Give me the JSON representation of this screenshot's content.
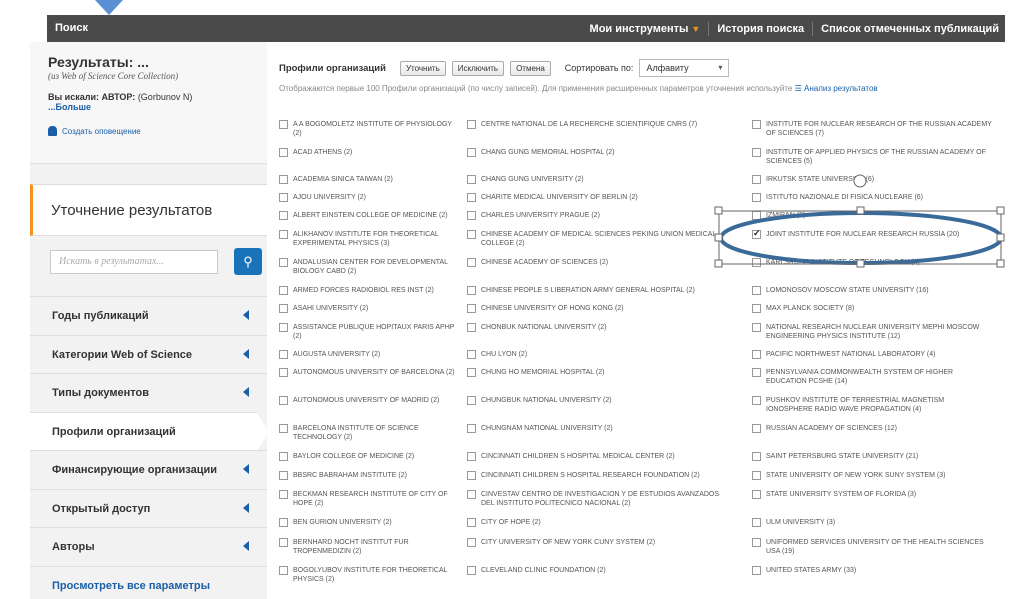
{
  "topbar": {
    "title": "Поиск",
    "tools": "Мои инструменты",
    "history": "История поиска",
    "marked": "Список отмеченных публикаций"
  },
  "sidebar": {
    "results_title": "Результаты: ...",
    "collection": "(из Web of Science Core Collection)",
    "searched_label": "Вы искали: АВТОР:",
    "searched_value": "(Gorbunov N)",
    "more": "...Больше",
    "create_alert": "Создать оповещение",
    "refine_title": "Уточнение результатов",
    "search_placeholder": "Искать в результатах...",
    "nav": [
      {
        "label": "Годы публикаций"
      },
      {
        "label": "Категории Web of Science"
      },
      {
        "label": "Типы документов"
      },
      {
        "label": "Профили организаций"
      },
      {
        "label": "Финансирующие организации"
      },
      {
        "label": "Открытый доступ"
      },
      {
        "label": "Авторы"
      },
      {
        "label": "Просмотреть все параметры"
      }
    ]
  },
  "main": {
    "heading": "Профили организаций",
    "btn_refine": "Уточнить",
    "btn_exclude": "Исключить",
    "btn_cancel": "Отмена",
    "sort_label": "Сортировать по:",
    "sort_value": "Алфавиту",
    "note": "Отображаются первые 100 Профили организаций (по числу записей). Для применения расширенных параметров уточнения используйте",
    "note_link": "Анализ результатов",
    "col1": [
      {
        "t": "A A BOGOMOLETZ INSTITUTE OF PHYSIOLOGY (2)",
        "c": false
      },
      {
        "t": "ACAD ATHENS (2)",
        "c": false
      },
      {
        "t": "ACADEMIA SINICA TAIWAN (2)",
        "c": false
      },
      {
        "t": "AJOU UNIVERSITY (2)",
        "c": false
      },
      {
        "t": "ALBERT EINSTEIN COLLEGE OF MEDICINE (2)",
        "c": false
      },
      {
        "t": "ALIKHANOV INSTITUTE FOR THEORETICAL EXPERIMENTAL PHYSICS (3)",
        "c": false
      },
      {
        "t": "ANDALUSIAN CENTER FOR DEVELOPMENTAL BIOLOGY CABD (2)",
        "c": false
      },
      {
        "t": "ARMED FORCES RADIOBIOL RES INST (2)",
        "c": false
      },
      {
        "t": "ASAHI UNIVERSITY (2)",
        "c": false
      },
      {
        "t": "ASSISTANCE PUBLIQUE HOPITAUX PARIS APHP (2)",
        "c": false
      },
      {
        "t": "AUGUSTA UNIVERSITY (2)",
        "c": false
      },
      {
        "t": "AUTONOMOUS UNIVERSITY OF BARCELONA (2)",
        "c": false
      },
      {
        "t": "AUTONOMOUS UNIVERSITY OF MADRID (2)",
        "c": false
      },
      {
        "t": "BARCELONA INSTITUTE OF SCIENCE TECHNOLOGY (2)",
        "c": false
      },
      {
        "t": "BAYLOR COLLEGE OF MEDICINE (2)",
        "c": false
      },
      {
        "t": "BBSRC BABRAHAM INSTITUTE (2)",
        "c": false
      },
      {
        "t": "BECKMAN RESEARCH INSTITUTE OF CITY OF HOPE (2)",
        "c": false
      },
      {
        "t": "BEN GURION UNIVERSITY (2)",
        "c": false
      },
      {
        "t": "BERNHARD NOCHT INSTITUT FUR TROPENMEDIZIN (2)",
        "c": false
      },
      {
        "t": "BOGOLYUBOV INSTITUTE FOR THEORETICAL PHYSICS (2)",
        "c": false
      }
    ],
    "col2": [
      {
        "t": "CENTRE NATIONAL DE LA RECHERCHE SCIENTIFIQUE CNRS (7)",
        "c": false
      },
      {
        "t": "CHANG GUNG MEMORIAL HOSPITAL (2)",
        "c": false
      },
      {
        "t": "CHANG GUNG UNIVERSITY (2)",
        "c": false
      },
      {
        "t": "CHARITE MEDICAL UNIVERSITY OF BERLIN (2)",
        "c": false
      },
      {
        "t": "CHARLES UNIVERSITY PRAGUE (2)",
        "c": false
      },
      {
        "t": "CHINESE ACADEMY OF MEDICAL SCIENCES PEKING UNION MEDICAL COLLEGE (2)",
        "c": false
      },
      {
        "t": "CHINESE ACADEMY OF SCIENCES (2)",
        "c": false
      },
      {
        "t": "CHINESE PEOPLE S LIBERATION ARMY GENERAL HOSPITAL (2)",
        "c": false
      },
      {
        "t": "CHINESE UNIVERSITY OF HONG KONG (2)",
        "c": false
      },
      {
        "t": "CHONBUK NATIONAL UNIVERSITY (2)",
        "c": false
      },
      {
        "t": "CHU LYON (2)",
        "c": false
      },
      {
        "t": "CHUNG HO MEMORIAL HOSPITAL (2)",
        "c": false
      },
      {
        "t": "CHUNGBUK NATIONAL UNIVERSITY (2)",
        "c": false
      },
      {
        "t": "CHUNGNAM NATIONAL UNIVERSITY (2)",
        "c": false
      },
      {
        "t": "CINCINNATI CHILDREN S HOSPITAL MEDICAL CENTER (2)",
        "c": false
      },
      {
        "t": "CINCINNATI CHILDREN S HOSPITAL RESEARCH FOUNDATION (2)",
        "c": false
      },
      {
        "t": "CINVESTAV CENTRO DE INVESTIGACION Y DE ESTUDIOS AVANZADOS DEL INSTITUTO POLITECNICO NACIONAL (2)",
        "c": false
      },
      {
        "t": "CITY OF HOPE (2)",
        "c": false
      },
      {
        "t": "CITY UNIVERSITY OF NEW YORK CUNY SYSTEM (2)",
        "c": false
      },
      {
        "t": "CLEVELAND CLINIC FOUNDATION (2)",
        "c": false
      }
    ],
    "col3": [
      {
        "t": "INSTITUTE FOR NUCLEAR RESEARCH OF THE RUSSIAN ACADEMY OF SCIENCES (7)",
        "c": false
      },
      {
        "t": "INSTITUTE OF APPLIED PHYSICS OF THE RUSSIAN ACADEMY OF SCIENCES (5)",
        "c": false
      },
      {
        "t": "IRKUTSK STATE UNIVERSITY (6)",
        "c": false
      },
      {
        "t": "ISTITUTO NAZIONALE DI FISICA NUCLEARE (6)",
        "c": false
      },
      {
        "t": "IZMIRAN (3)",
        "c": false
      },
      {
        "t": "JOINT INSTITUTE FOR NUCLEAR RESEARCH RUSSIA (20)",
        "c": true
      },
      {
        "t": "KARLSRUHE INSTITUTE OF TECHNOLOGY (3)",
        "c": false
      },
      {
        "t": "LOMONOSOV MOSCOW STATE UNIVERSITY (16)",
        "c": false
      },
      {
        "t": "MAX PLANCK SOCIETY (8)",
        "c": false
      },
      {
        "t": "NATIONAL RESEARCH NUCLEAR UNIVERSITY MEPHI MOSCOW ENGINEERING PHYSICS INSTITUTE (12)",
        "c": false
      },
      {
        "t": "PACIFIC NORTHWEST NATIONAL LABORATORY (4)",
        "c": false
      },
      {
        "t": "PENNSYLVANIA COMMONWEALTH SYSTEM OF HIGHER EDUCATION PCSHE (14)",
        "c": false
      },
      {
        "t": "PUSHKOV INSTITUTE OF TERRESTRIAL MAGNETISM IONOSPHERE RADIO WAVE PROPAGATION (4)",
        "c": false
      },
      {
        "t": "RUSSIAN ACADEMY OF SCIENCES (12)",
        "c": false
      },
      {
        "t": "SAINT PETERSBURG STATE UNIVERSITY (21)",
        "c": false
      },
      {
        "t": "STATE UNIVERSITY OF NEW YORK SUNY SYSTEM (3)",
        "c": false
      },
      {
        "t": "STATE UNIVERSITY SYSTEM OF FLORIDA (3)",
        "c": false
      },
      {
        "t": "ULM UNIVERSITY (3)",
        "c": false
      },
      {
        "t": "UNIFORMED SERVICES UNIVERSITY OF THE HEALTH SCIENCES USA (19)",
        "c": false
      },
      {
        "t": "UNITED STATES ARMY (33)",
        "c": false
      }
    ]
  },
  "colors": {
    "accent": "#f0941e",
    "link": "#1a5fa8",
    "button": "#1a73b8",
    "annotation": "#3a6a9a"
  }
}
